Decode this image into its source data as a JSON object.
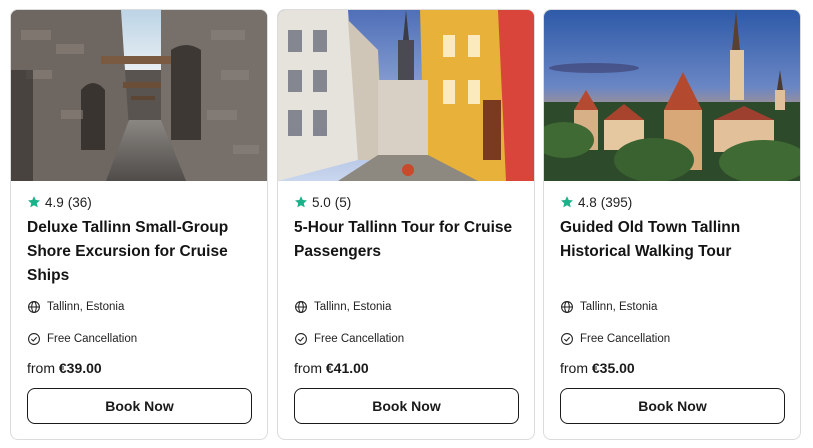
{
  "colors": {
    "star": "#1bb28a",
    "border": "#dcdcdc",
    "text": "#1a1a1a"
  },
  "cards": [
    {
      "image": "medieval-stone-archway-street",
      "rating": "4.9",
      "reviews": "(36)",
      "title": "Deluxe Tallinn Small-Group Shore Excursion for Cruise Ships",
      "location": "Tallinn, Estonia",
      "cancellation": "Free Cancellation",
      "price_prefix": "from",
      "price": "€39.00",
      "cta": "Book Now"
    },
    {
      "image": "colorful-old-town-street",
      "rating": "5.0",
      "reviews": "(5)",
      "title": "5-Hour Tallinn Tour for Cruise Passengers",
      "location": "Tallinn, Estonia",
      "cancellation": "Free Cancellation",
      "price_prefix": "from",
      "price": "€41.00",
      "cta": "Book Now"
    },
    {
      "image": "old-town-skyline-at-sunset",
      "rating": "4.8",
      "reviews": "(395)",
      "title": "Guided Old Town Tallinn Historical Walking Tour",
      "location": "Tallinn, Estonia",
      "cancellation": "Free Cancellation",
      "price_prefix": "from",
      "price": "€35.00",
      "cta": "Book Now"
    }
  ]
}
